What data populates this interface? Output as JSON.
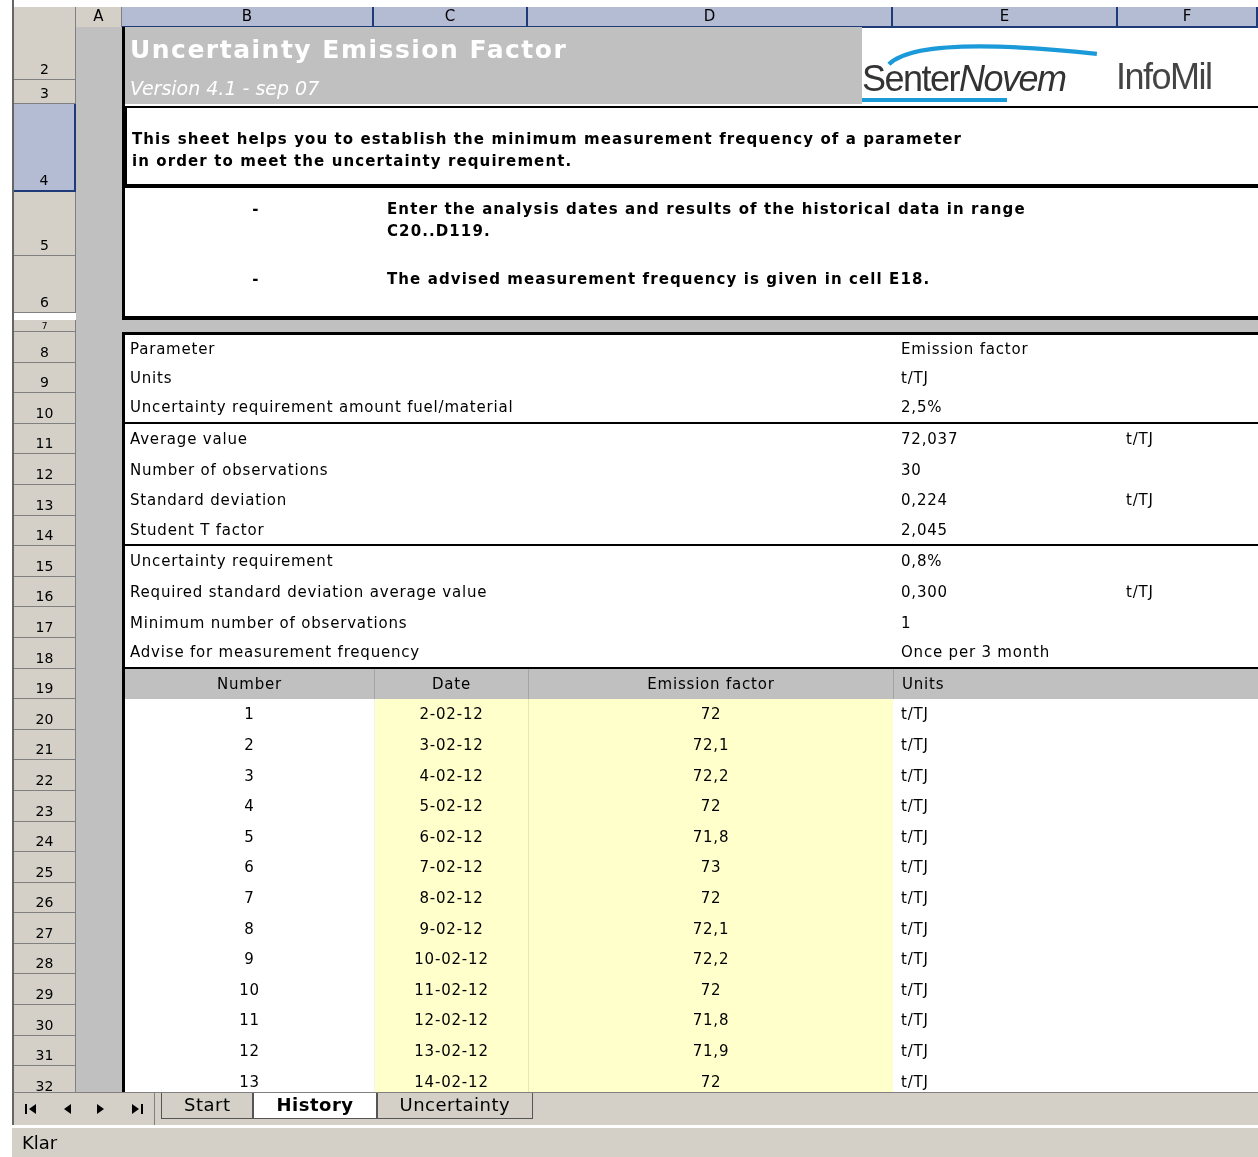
{
  "column_headers": [
    {
      "label": "A",
      "selected": false
    },
    {
      "label": "B",
      "selected": true
    },
    {
      "label": "C",
      "selected": true
    },
    {
      "label": "D",
      "selected": true
    },
    {
      "label": "E",
      "selected": true
    },
    {
      "label": "F",
      "selected": true
    }
  ],
  "row_headers": [
    {
      "label": "2",
      "selected": false
    },
    {
      "label": "3",
      "selected": false
    },
    {
      "label": "4",
      "selected": true
    },
    {
      "label": "5",
      "selected": false
    },
    {
      "label": "6",
      "selected": false
    },
    {
      "label": "7",
      "selected": false
    },
    {
      "label": "8",
      "selected": false
    },
    {
      "label": "9",
      "selected": false
    },
    {
      "label": "10",
      "selected": false
    },
    {
      "label": "11",
      "selected": false
    },
    {
      "label": "12",
      "selected": false
    },
    {
      "label": "13",
      "selected": false
    },
    {
      "label": "14",
      "selected": false
    },
    {
      "label": "15",
      "selected": false
    },
    {
      "label": "16",
      "selected": false
    },
    {
      "label": "17",
      "selected": false
    },
    {
      "label": "18",
      "selected": false
    },
    {
      "label": "19",
      "selected": false
    },
    {
      "label": "20",
      "selected": false
    },
    {
      "label": "21",
      "selected": false
    },
    {
      "label": "22",
      "selected": false
    },
    {
      "label": "23",
      "selected": false
    },
    {
      "label": "24",
      "selected": false
    },
    {
      "label": "25",
      "selected": false
    },
    {
      "label": "26",
      "selected": false
    },
    {
      "label": "27",
      "selected": false
    },
    {
      "label": "28",
      "selected": false
    },
    {
      "label": "29",
      "selected": false
    },
    {
      "label": "30",
      "selected": false
    },
    {
      "label": "31",
      "selected": false
    },
    {
      "label": "32",
      "selected": false
    }
  ],
  "title": "Uncertainty Emission Factor",
  "version": "Version 4.1 - sep 07",
  "logo": {
    "brand_1": "Senter",
    "brand_1_italic": "Novem",
    "brand_2": "InfoMil"
  },
  "intro_lines": [
    "This sheet helps you to establish the minimum measurement frequency of a parameter",
    "in order to meet the uncertainty requirement."
  ],
  "instructions": [
    {
      "bullet": "-",
      "lines": [
        "Enter the analysis dates and results of the historical data in range",
        "C20..D119."
      ]
    },
    {
      "bullet": "-",
      "lines": [
        "The advised measurement frequency is given in cell E18."
      ]
    }
  ],
  "parameter_groups": [
    [
      {
        "label": "Parameter",
        "value": "Emission factor"
      },
      {
        "label": "Units",
        "value": "t/TJ"
      },
      {
        "label": "Uncertainty requirement amount fuel/material",
        "value": "2,5%"
      }
    ],
    [
      {
        "label": "Average value",
        "value": "72,037",
        "unit": "t/TJ"
      },
      {
        "label": "Number of observations",
        "value": "30"
      },
      {
        "label": "Standard deviation",
        "value": "0,224",
        "unit": "t/TJ"
      },
      {
        "label": "Student T factor",
        "value": "2,045"
      }
    ],
    [
      {
        "label": "Uncertainty requirement",
        "value": "0,8%"
      },
      {
        "label": "Required standard deviation average value",
        "value": "0,300",
        "unit": "t/TJ"
      },
      {
        "label": "Minimum number of observations",
        "value": "1"
      },
      {
        "label": "Advise for measurement frequency",
        "value": "Once per 3 month"
      }
    ]
  ],
  "table": {
    "columns": [
      "Number",
      "Date",
      "Emission factor",
      "Units"
    ],
    "rows": [
      [
        "1",
        "2-02-12",
        "72",
        "t/TJ"
      ],
      [
        "2",
        "3-02-12",
        "72,1",
        "t/TJ"
      ],
      [
        "3",
        "4-02-12",
        "72,2",
        "t/TJ"
      ],
      [
        "4",
        "5-02-12",
        "72",
        "t/TJ"
      ],
      [
        "5",
        "6-02-12",
        "71,8",
        "t/TJ"
      ],
      [
        "6",
        "7-02-12",
        "73",
        "t/TJ"
      ],
      [
        "7",
        "8-02-12",
        "72",
        "t/TJ"
      ],
      [
        "8",
        "9-02-12",
        "72,1",
        "t/TJ"
      ],
      [
        "9",
        "10-02-12",
        "72,2",
        "t/TJ"
      ],
      [
        "10",
        "11-02-12",
        "72",
        "t/TJ"
      ],
      [
        "11",
        "12-02-12",
        "71,8",
        "t/TJ"
      ],
      [
        "12",
        "13-02-12",
        "71,9",
        "t/TJ"
      ],
      [
        "13",
        "14-02-12",
        "72",
        "t/TJ"
      ]
    ]
  },
  "sheet_tabs": [
    {
      "label": "Start",
      "selected": false
    },
    {
      "label": "History",
      "selected": true
    },
    {
      "label": "Uncertainty",
      "selected": false
    }
  ],
  "status_bar": "Klar"
}
